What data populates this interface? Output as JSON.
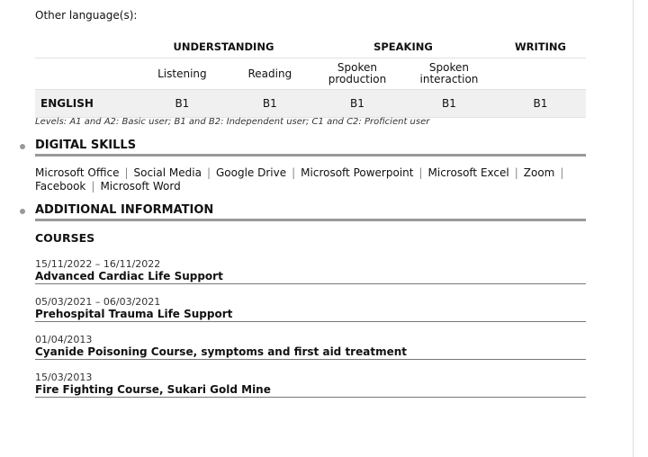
{
  "languages": {
    "other_label": "Other language(s):",
    "headers": {
      "understanding": "UNDERSTANDING",
      "speaking": "SPEAKING",
      "writing": "WRITING"
    },
    "sub": {
      "listening": "Listening",
      "reading": "Reading",
      "spoken_production": "Spoken production",
      "spoken_interaction": "Spoken interaction"
    },
    "rows": [
      {
        "language": "ENGLISH",
        "listening": "B1",
        "reading": "B1",
        "spoken_production": "B1",
        "spoken_interaction": "B1",
        "writing": "B1"
      }
    ],
    "levels_note": "Levels: A1 and A2: Basic user; B1 and B2: Independent user; C1 and C2: Proficient user"
  },
  "digital_skills": {
    "title": "DIGITAL SKILLS",
    "items": [
      "Microsoft Office",
      "Social Media",
      "Google Drive",
      "Microsoft Powerpoint",
      "Microsoft Excel",
      "Zoom",
      "Facebook",
      "Microsoft Word"
    ]
  },
  "additional": {
    "title": "ADDITIONAL INFORMATION",
    "courses_title": "COURSES",
    "courses": [
      {
        "date": "15/11/2022 – 16/11/2022",
        "title": "Advanced Cardiac Life Support"
      },
      {
        "date": "05/03/2021 – 06/03/2021",
        "title": "Prehospital Trauma Life Support"
      },
      {
        "date": "01/04/2013",
        "title": "Cyanide Poisoning Course, symptoms and first aid treatment"
      },
      {
        "date": "15/03/2013",
        "title": "Fire Fighting Course, Sukari Gold Mine"
      }
    ]
  }
}
